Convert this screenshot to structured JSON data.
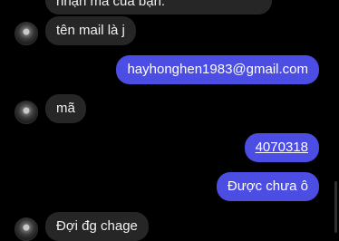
{
  "messages": [
    {
      "id": "m0",
      "side": "in",
      "text": "nhận mã của bạn:"
    },
    {
      "id": "m1",
      "side": "in",
      "text": "tên mail là j"
    },
    {
      "id": "m2",
      "side": "out",
      "text": "hayhonghen1983@gmail.com"
    },
    {
      "id": "m3",
      "side": "in",
      "text": "mã"
    },
    {
      "id": "m4",
      "side": "out",
      "text": "4070318"
    },
    {
      "id": "m5",
      "side": "out",
      "text": "Được chưa ô"
    },
    {
      "id": "m6",
      "side": "in",
      "text": "Đợi đg chage"
    }
  ],
  "colors": {
    "background": "#000000",
    "incoming_bubble": "#262626",
    "outgoing_bubble": "#4b4de3"
  }
}
